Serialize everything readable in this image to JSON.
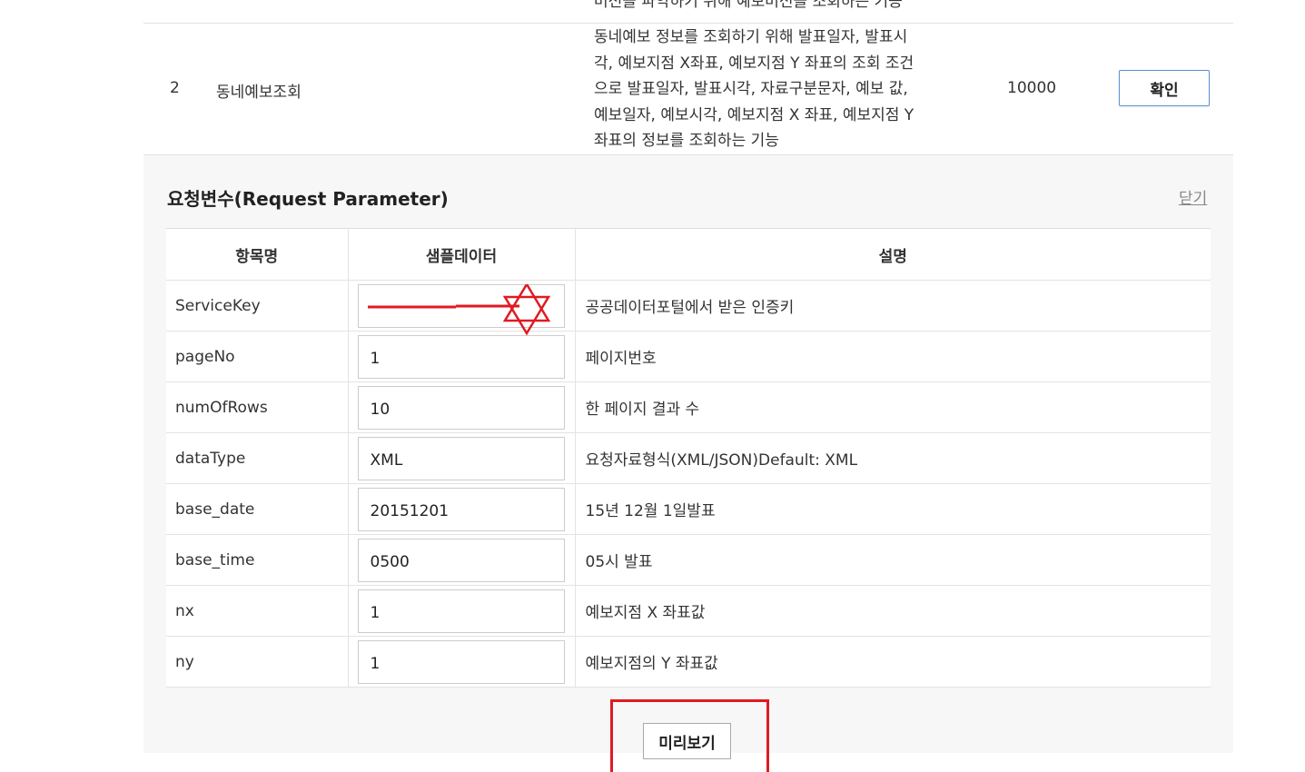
{
  "operations": {
    "top_desc_tail": "버전을 파악하기 위해 예보버전을 조회하는 기능",
    "row": {
      "number": "2",
      "name": "동네예보조회",
      "description_lines": [
        "동네예보 정보를 조회하기 위해 발표일자, 발표시",
        "각, 예보지점 X좌표, 예보지점 Y 좌표의 조회 조건",
        "으로 발표일자, 발표시각, 자료구분문자, 예보 값,",
        "예보일자, 예보시각, 예보지점 X 좌표, 예보지점 Y",
        "좌표의 정보를 조회하는 기능"
      ],
      "traffic": "10000",
      "confirm_label": "확인"
    }
  },
  "request_panel": {
    "title": "요청변수(Request Parameter)",
    "close_label": "닫기",
    "headers": {
      "name": "항목명",
      "sample": "샘플데이터",
      "description": "설명"
    },
    "params": [
      {
        "name": "ServiceKey",
        "value": "",
        "description": "공공데이터포털에서 받은 인증키"
      },
      {
        "name": "pageNo",
        "value": "1",
        "description": "페이지번호"
      },
      {
        "name": "numOfRows",
        "value": "10",
        "description": "한 페이지 결과 수"
      },
      {
        "name": "dataType",
        "value": "XML",
        "description": "요청자료형식(XML/JSON)Default: XML"
      },
      {
        "name": "base_date",
        "value": "20151201",
        "description": "15년 12월 1일발표"
      },
      {
        "name": "base_time",
        "value": "0500",
        "description": "05시 발표"
      },
      {
        "name": "nx",
        "value": "1",
        "description": "예보지점 X 좌표값"
      },
      {
        "name": "ny",
        "value": "1",
        "description": "예보지점의 Y 좌표값"
      }
    ],
    "preview_label": "미리보기"
  },
  "colors": {
    "annotation": "#e01a22",
    "button_border": "#5b8fd6",
    "panel_bg": "#f7f7f7"
  }
}
